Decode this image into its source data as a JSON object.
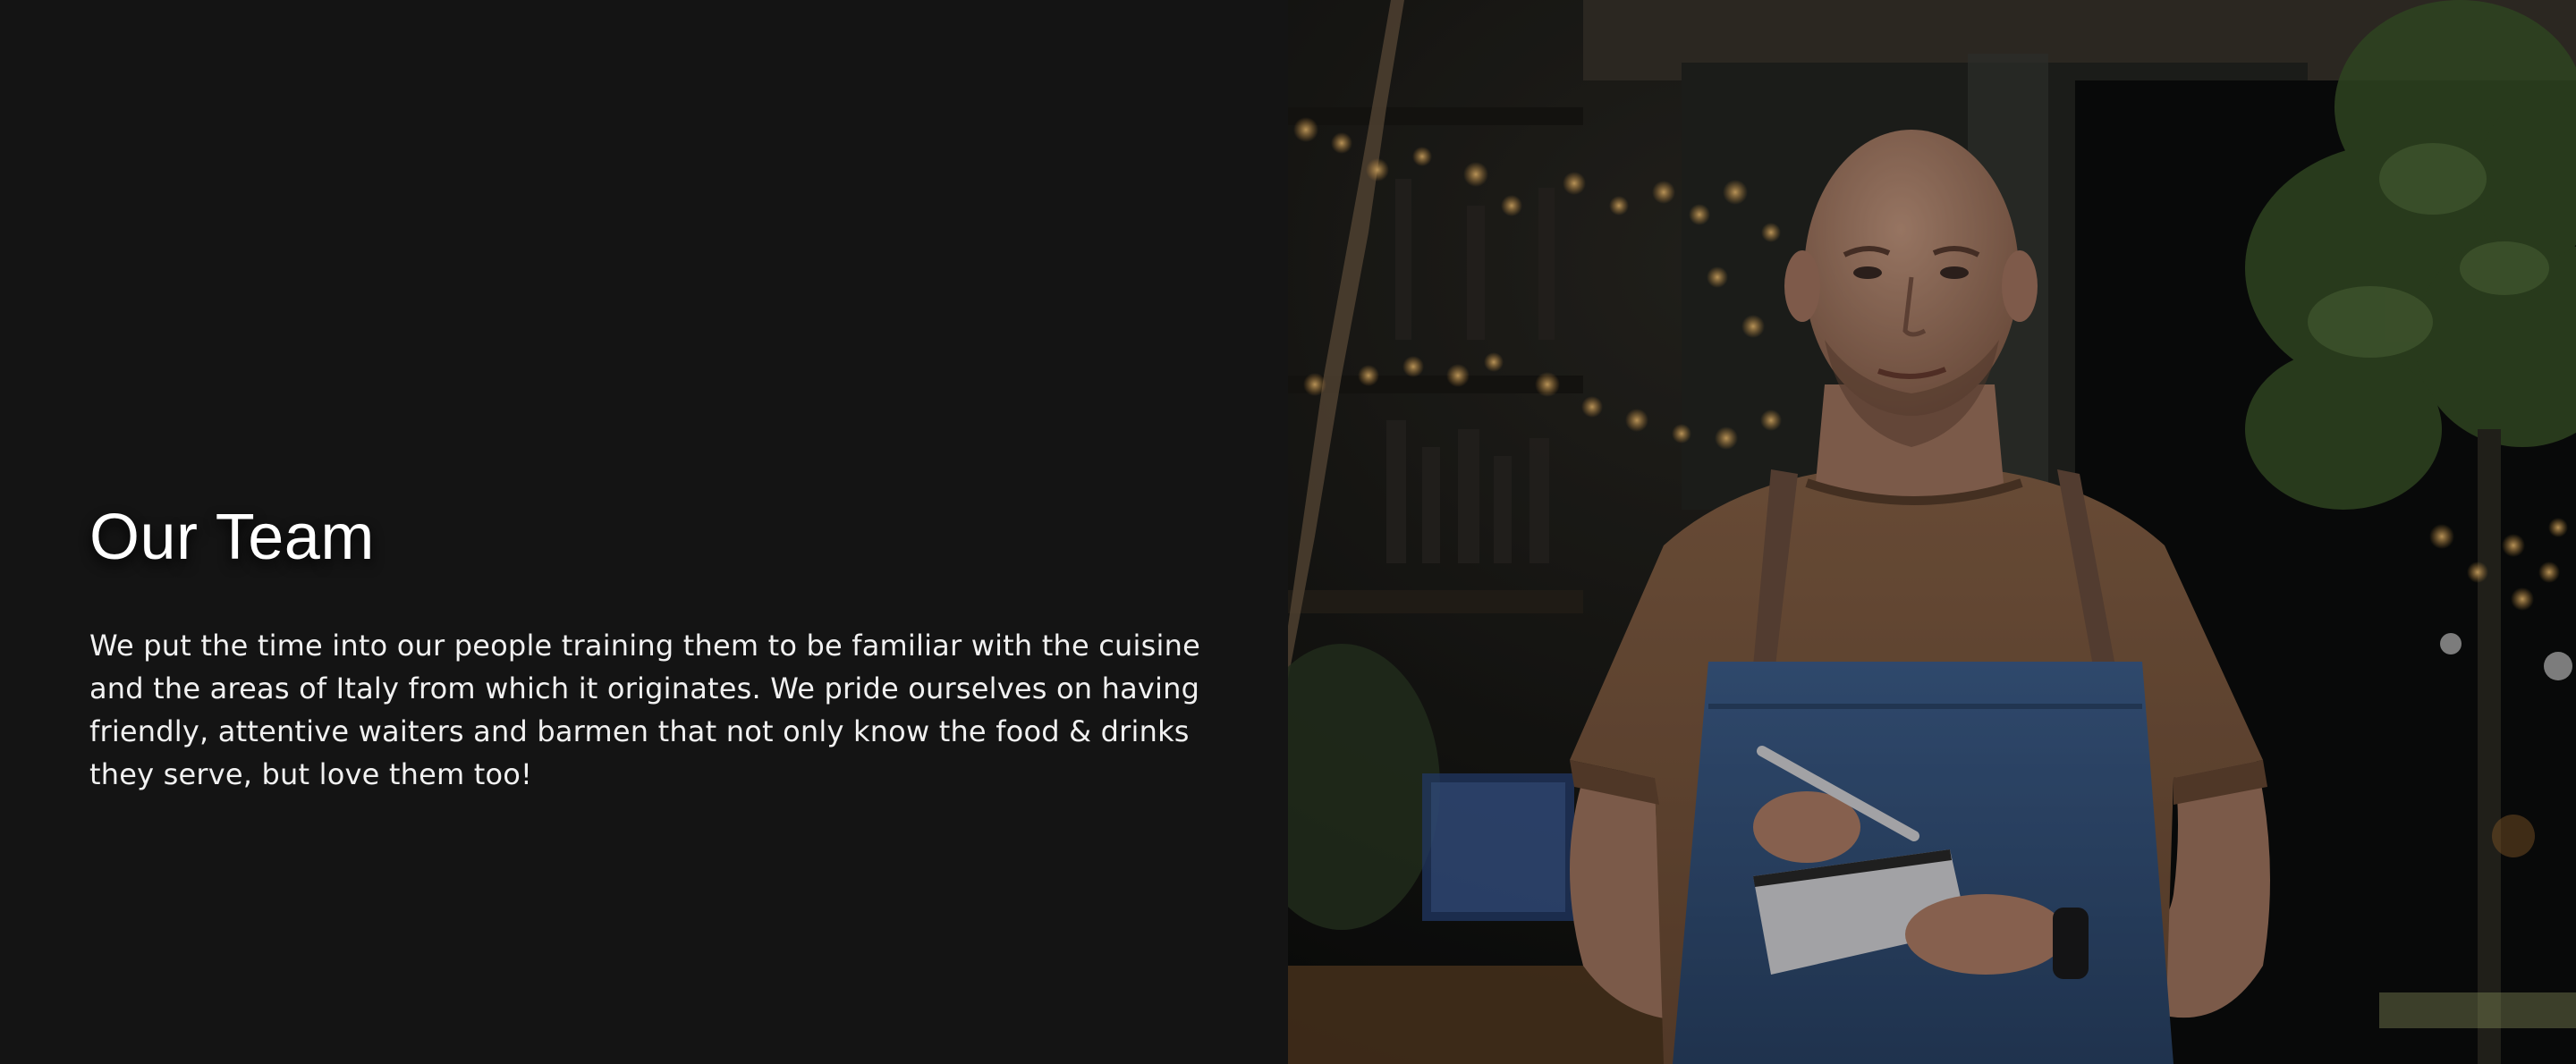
{
  "team": {
    "title": "Our Team",
    "description": "We put the time into our people training them to be familiar with the cuisine and the areas of Italy from which it originates. We pride ourselves on having friendly, attentive waiters and barmen that not only know the food & drinks they serve, but love them too!"
  },
  "colors": {
    "background": "#141414",
    "text": "#ffffff",
    "shirt": "#8a6448",
    "apron": "#3b5c86",
    "foliage": "#3e5a2b",
    "bokeh": "#e8a64a"
  },
  "photo": {
    "subject": "waiter-with-notepad"
  }
}
